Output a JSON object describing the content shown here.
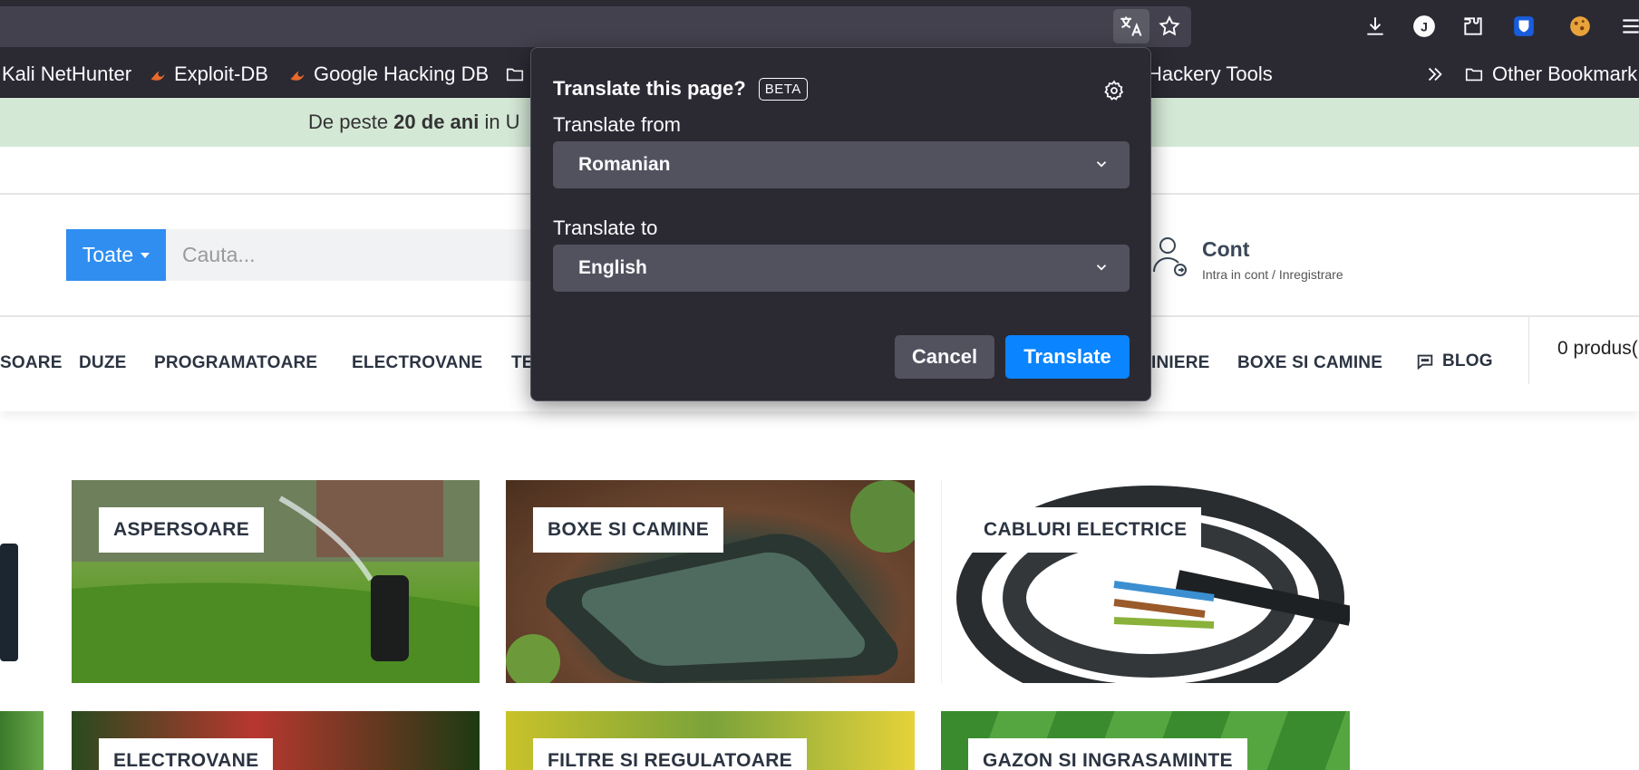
{
  "bookmarks": [
    {
      "label": "Kali NetHunter"
    },
    {
      "label": "Exploit-DB"
    },
    {
      "label": "Google Hacking DB"
    },
    {
      "label": "Hackery Tools"
    },
    {
      "label": "Other Bookmark"
    }
  ],
  "promo": {
    "pre": "De peste ",
    "bold": "20 de ani",
    "post": " in U"
  },
  "search": {
    "category": "Toate",
    "placeholder": "Cauta..."
  },
  "account": {
    "title": "Cont",
    "subtitle": "Intra in cont / Inregistrare"
  },
  "nav": {
    "items": [
      "SOARE",
      "DUZE",
      "PROGRAMATOARE",
      "ELECTROVANE",
      "TE",
      "INIERE",
      "BOXE SI CAMINE",
      "BLOG"
    ],
    "cart": "0 produs("
  },
  "categories": [
    "ASPERSOARE",
    "BOXE SI CAMINE",
    "CABLURI ELECTRICE",
    "ELECTROVANE",
    "FILTRE SI REGULATOARE",
    "GAZON SI INGRASAMINTE"
  ],
  "translate_popup": {
    "title": "Translate this page?",
    "badge": "BETA",
    "from_label": "Translate from",
    "from_value": "Romanian",
    "to_label": "Translate to",
    "to_value": "English",
    "cancel": "Cancel",
    "translate": "Translate"
  },
  "colors": {
    "accent_blue": "#0a84ff",
    "chrome_bg": "#2b2a33",
    "promo_bg": "#d4e8d6",
    "search_cat": "#2f8ef0"
  }
}
